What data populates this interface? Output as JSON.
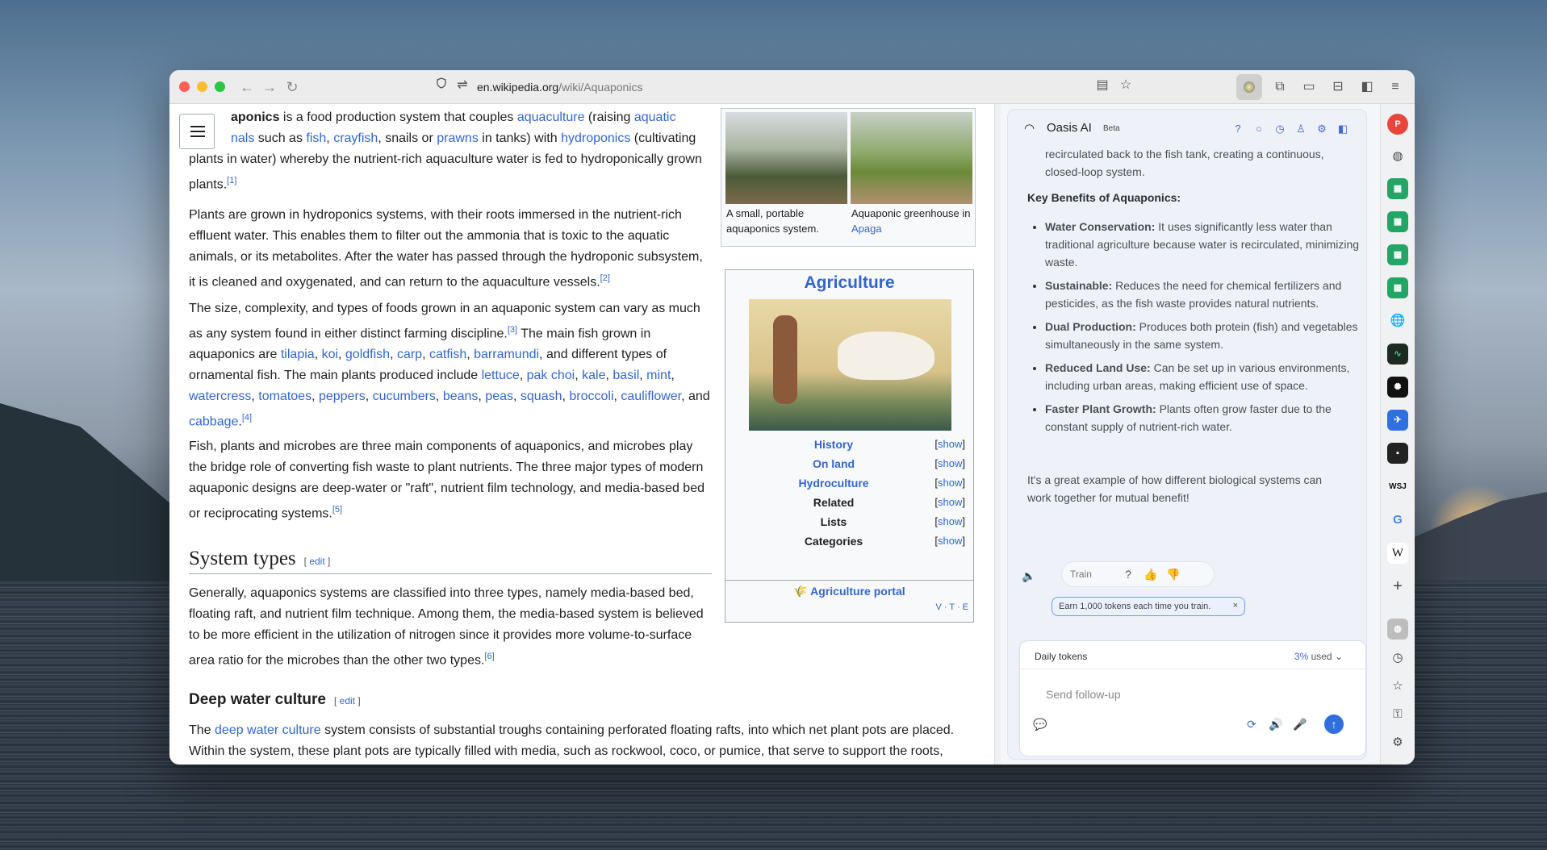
{
  "browser": {
    "url_domain": "en.wikipedia.org",
    "url_path": "/wiki/Aquaponics"
  },
  "article": {
    "p1": {
      "lead": "aponics",
      "t1": " is a food production system that couples ",
      "l_aquaculture": "aquaculture",
      "t2": " (raising ",
      "l_aquatic": "aquatic",
      "l_nals": "nals",
      "t3": " such as ",
      "l_fish": "fish",
      "l_crayfish": "crayfish",
      "t4": ", snails or ",
      "l_prawns": "prawns",
      "t5": " in tanks) with ",
      "l_hydroponics": "hydroponics",
      "t6": " (cultivating plants in water) whereby the nutrient-rich aquaculture water is fed to hydroponically grown plants.",
      "ref": "[1]"
    },
    "p2": {
      "text": "Plants are grown in hydroponics systems, with their roots immersed in the nutrient-rich effluent water. This enables them to filter out the ammonia that is toxic to the aquatic animals, or its metabolites. After the water has passed through the hydroponic subsystem, it is cleaned and oxygenated, and can return to the aquaculture vessels.",
      "ref": "[2]"
    },
    "p3": {
      "t1": "The size, complexity, and types of foods grown in an aquaponic system can vary as much as any system found in either distinct farming discipline.",
      "ref3": "[3]",
      "t2": " The main fish grown in aquaponics are ",
      "fish": [
        "tilapia",
        "koi",
        "goldfish",
        "carp",
        "catfish",
        "barramundi"
      ],
      "t3": ", and different types of ornamental fish. The main plants produced include ",
      "plants": [
        "lettuce",
        "pak choi",
        "kale",
        "basil",
        "mint",
        "watercress",
        "tomatoes",
        "peppers",
        "cucumbers",
        "beans",
        "peas",
        "squash",
        "broccoli",
        "cauliflower"
      ],
      "and": "and",
      "last": "cabbage",
      "ref4": "[4]"
    },
    "p4": {
      "text": "Fish, plants and microbes are three main components of aquaponics, and microbes play the bridge role of converting fish waste to plant nutrients. The three major types of modern aquaponic designs are deep-water or \"raft\", nutrient film technology, and media-based bed or reciprocating systems.",
      "ref": "[5]"
    },
    "h2": "System types",
    "edit": "edit",
    "p5": {
      "text": "Generally, aquaponics systems are classified into three types, namely media-based bed, floating raft, and nutrient film technique. Among them, the media-based system is believed to be more efficient in the utilization of nitrogen since it provides more volume-to-surface area ratio for the microbes than the other two types.",
      "ref": "[6]"
    },
    "h3": "Deep water culture",
    "p6": {
      "t1": "The ",
      "link": "deep water culture",
      "t2": " system consists of substantial troughs containing perforated floating rafts, into which net plant pots are placed. Within the system, these plant pots are typically filled with media, such as rockwool, coco, or pumice, that serve to support the roots,"
    },
    "image_captions": {
      "left": "A small, portable aquaponics system.",
      "right_text": "Aquaponic greenhouse in ",
      "right_link": "Apaga"
    },
    "infobox": {
      "title": "Agriculture",
      "rows": [
        {
          "label": "History",
          "link": true
        },
        {
          "label": "On land",
          "link": true
        },
        {
          "label": "Hydroculture",
          "link": true
        },
        {
          "label": "Related",
          "link": false
        },
        {
          "label": "Lists",
          "link": false
        },
        {
          "label": "Categories",
          "link": false
        }
      ],
      "show": "show",
      "portal": "Agriculture portal",
      "vte": "V · T · E"
    }
  },
  "ai_panel": {
    "title": "Oasis AI",
    "badge": "Beta",
    "intro": "recirculated back to the fish tank, creating a continuous, closed-loop system.",
    "benefits_heading": "Key Benefits of Aquaponics:",
    "benefits": [
      {
        "name": "Water Conservation:",
        "text": " It uses significantly less water than traditional agriculture because water is recirculated, minimizing waste."
      },
      {
        "name": "Sustainable:",
        "text": " Reduces the need for chemical fertilizers and pesticides, as the fish waste provides natural nutrients."
      },
      {
        "name": "Dual Production:",
        "text": " Produces both protein (fish) and vegetables simultaneously in the same system."
      },
      {
        "name": "Reduced Land Use:",
        "text": " Can be set up in various environments, including urban areas, making efficient use of space."
      },
      {
        "name": "Faster Plant Growth:",
        "text": " Plants often grow faster due to the constant supply of nutrient-rich water."
      }
    ],
    "closing": "It's a great example of how different biological systems can work together for mutual benefit!",
    "train_label": "Train",
    "earn_text": "Earn 1,000 tokens each time you train.",
    "daily_tokens": "Daily tokens",
    "used_pct": "3%",
    "used_label": "used",
    "placeholder": "Send follow-up"
  },
  "sidebar": {
    "wsj": "WSJ",
    "wiki": "W",
    "google": "G"
  }
}
